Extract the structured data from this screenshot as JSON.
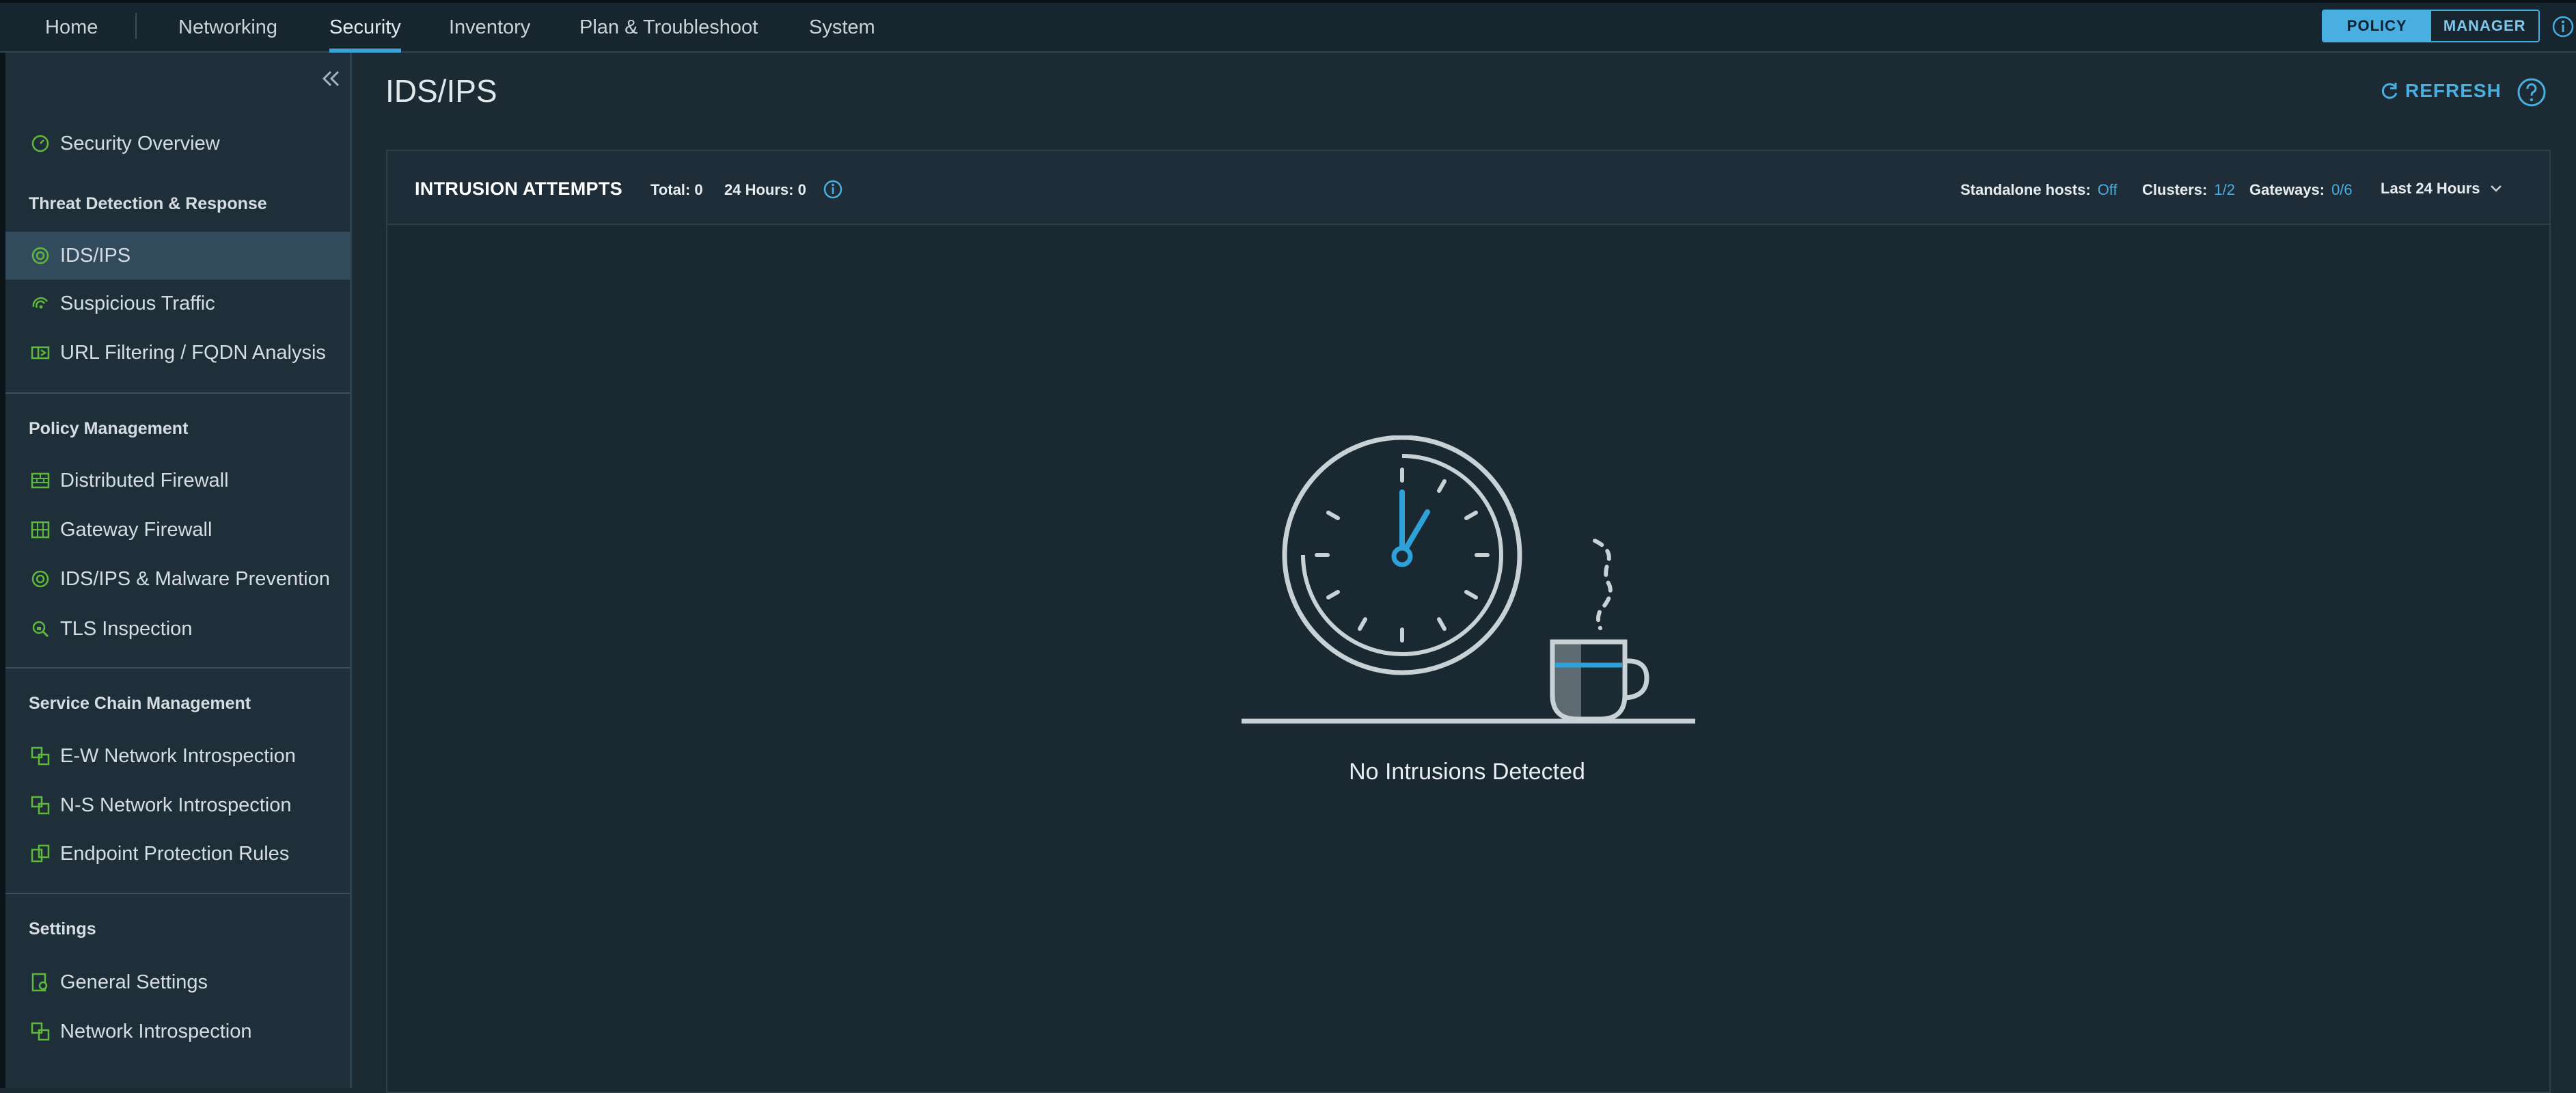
{
  "topnav": {
    "items": [
      {
        "label": "Home"
      },
      {
        "label": "Networking"
      },
      {
        "label": "Security",
        "active": true
      },
      {
        "label": "Inventory"
      },
      {
        "label": "Plan & Troubleshoot"
      },
      {
        "label": "System"
      }
    ],
    "mode_policy": "POLICY",
    "mode_manager": "MANAGER",
    "active_mode": "POLICY"
  },
  "sidebar": {
    "overview": "Security Overview",
    "sections": [
      {
        "header": "Threat Detection & Response",
        "items": [
          "IDS/IPS",
          "Suspicious Traffic",
          "URL Filtering / FQDN Analysis"
        ]
      },
      {
        "header": "Policy Management",
        "items": [
          "Distributed Firewall",
          "Gateway Firewall",
          "IDS/IPS & Malware Prevention",
          "TLS Inspection"
        ]
      },
      {
        "header": "Service Chain Management",
        "items": [
          "E-W Network Introspection",
          "N-S Network Introspection",
          "Endpoint Protection Rules"
        ]
      },
      {
        "header": "Settings",
        "items": [
          "General Settings",
          "Network Introspection"
        ]
      }
    ],
    "selected": "IDS/IPS"
  },
  "page": {
    "title": "IDS/IPS",
    "refresh_label": "REFRESH"
  },
  "panel": {
    "title": "INTRUSION ATTEMPTS",
    "total": "Total: 0",
    "last24": "24 Hours: 0",
    "standalone_label": "Standalone hosts:",
    "standalone_value": "Off",
    "clusters_label": "Clusters:",
    "clusters_value": "1/2",
    "gateways_label": "Gateways:",
    "gateways_value": "0/6",
    "time_range": "Last 24 Hours",
    "empty_message": "No Intrusions Detected"
  },
  "colors": {
    "accent": "#49aee0",
    "icon_green": "#5fb83b",
    "background": "#1b2a33"
  }
}
